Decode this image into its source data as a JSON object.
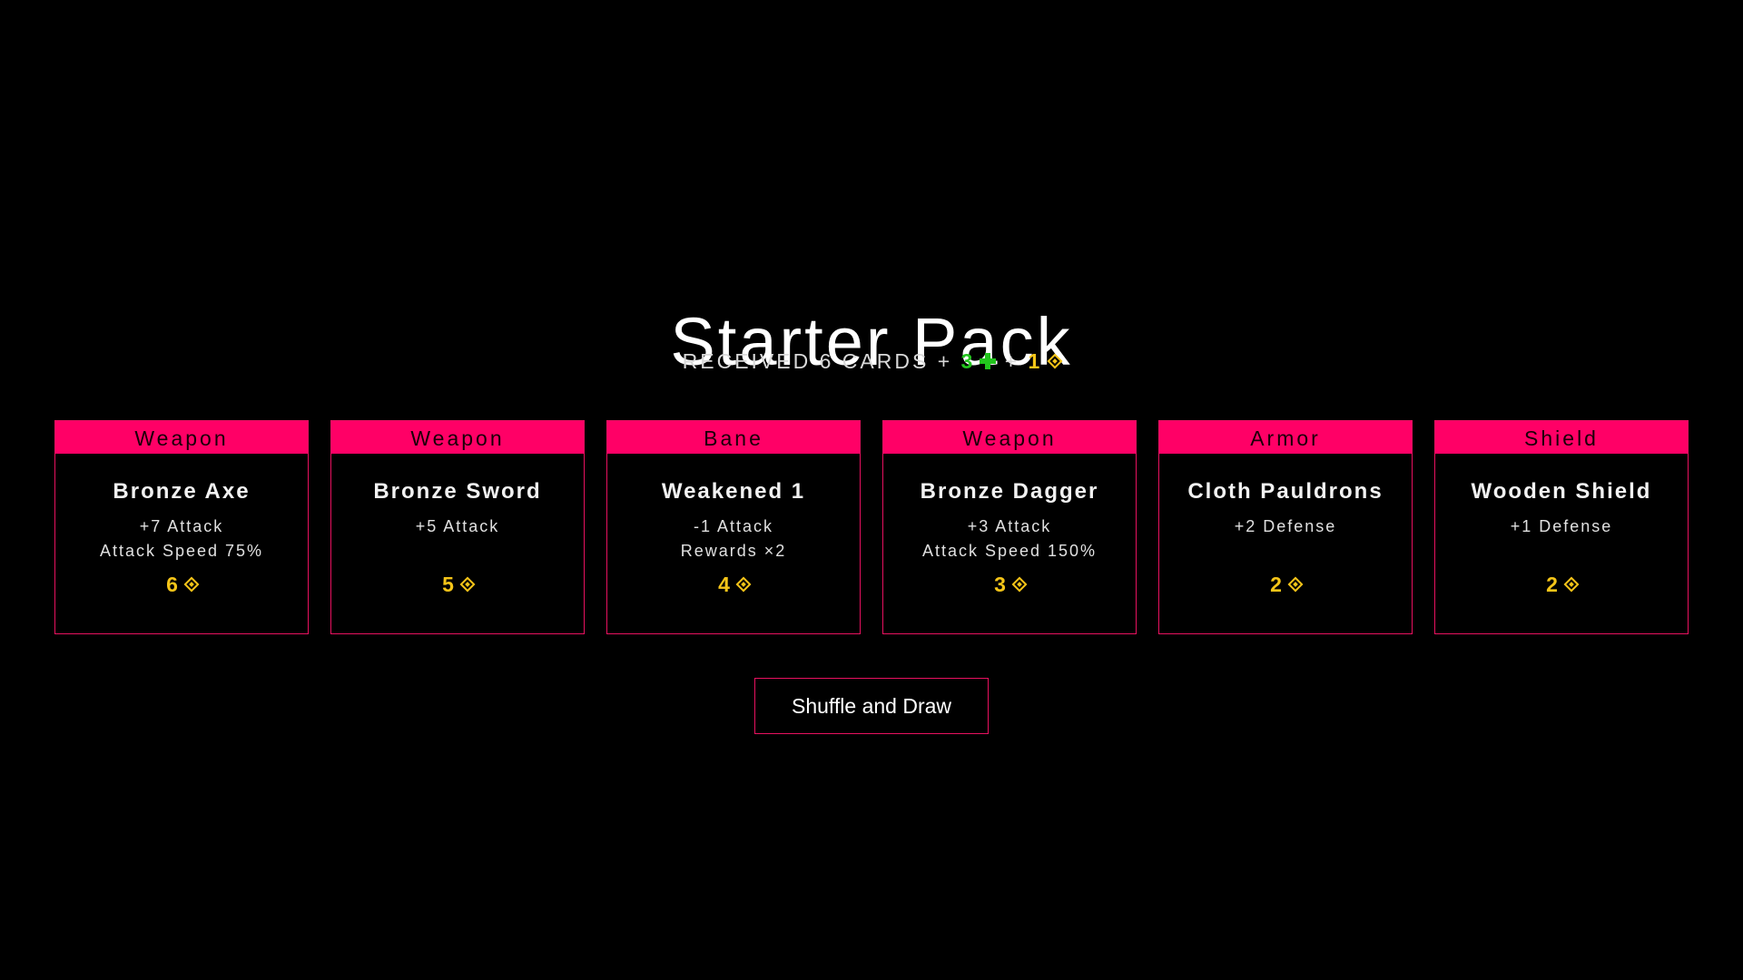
{
  "pack": {
    "title": "Starter Pack",
    "received_label": "RECEIVED 6 CARDS",
    "plus_sign": "+",
    "heal_bonus": "3",
    "gold_bonus": "1"
  },
  "cards": [
    {
      "type": "Weapon",
      "name": "Bronze Axe",
      "stats": [
        "+7 Attack",
        "Attack Speed 75%"
      ],
      "cost": "6"
    },
    {
      "type": "Weapon",
      "name": "Bronze Sword",
      "stats": [
        "+5 Attack",
        ""
      ],
      "cost": "5"
    },
    {
      "type": "Bane",
      "name": "Weakened 1",
      "stats": [
        "-1 Attack",
        "Rewards ×2"
      ],
      "cost": "4"
    },
    {
      "type": "Weapon",
      "name": "Bronze Dagger",
      "stats": [
        "+3 Attack",
        "Attack Speed 150%"
      ],
      "cost": "3"
    },
    {
      "type": "Armor",
      "name": "Cloth Pauldrons",
      "stats": [
        "+2 Defense",
        ""
      ],
      "cost": "2"
    },
    {
      "type": "Shield",
      "name": "Wooden Shield",
      "stats": [
        "+1 Defense",
        ""
      ],
      "cost": "2"
    }
  ],
  "actions": {
    "shuffle_label": "Shuffle and Draw"
  },
  "icons": {
    "heal": "green-cross-icon",
    "gold": "gold-diamond-icon"
  },
  "colors": {
    "background": "#000000",
    "accent": "#ff0066",
    "card_border": "#e8115f",
    "gold": "#f5c518",
    "heal": "#22c41d"
  }
}
